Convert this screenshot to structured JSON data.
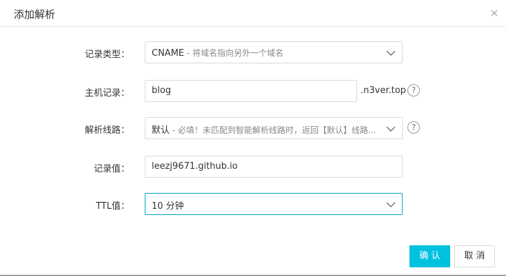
{
  "dialog": {
    "title": "添加解析"
  },
  "form": {
    "record_type": {
      "label": "记录类型：",
      "value": "CNAME",
      "description": " - 将域名指向另外一个域名"
    },
    "host": {
      "label": "主机记录：",
      "value": "blog",
      "suffix": ".n3ver.top"
    },
    "line": {
      "label": "解析线路：",
      "value": "默认",
      "description": " - 必填！未匹配到智能解析线路时，返回【默认】线路..."
    },
    "record_value": {
      "label": "记录值：",
      "value": "leezj9671.github.io"
    },
    "ttl": {
      "label": "TTL值：",
      "value": "10 分钟"
    }
  },
  "buttons": {
    "confirm": "确 认",
    "cancel": "取 消"
  },
  "icons": {
    "help": "?"
  },
  "colors": {
    "accent": "#00c1de",
    "focus_border": "#00a2ca",
    "border": "#d9d9d9"
  }
}
